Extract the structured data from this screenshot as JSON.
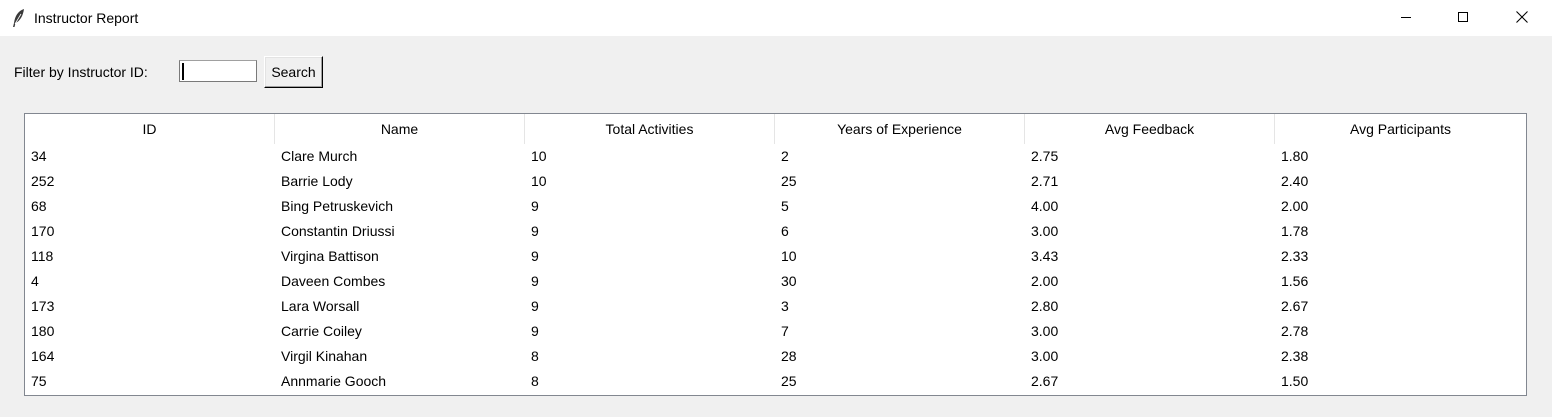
{
  "window": {
    "title": "Instructor Report",
    "icon": "feather-icon",
    "controls": [
      "minimize-icon",
      "maximize-icon",
      "close-icon"
    ]
  },
  "filter": {
    "label": "Filter by Instructor ID:",
    "value": "",
    "button_label": "Search"
  },
  "table": {
    "columns": [
      "ID",
      "Name",
      "Total Activities",
      "Years of Experience",
      "Avg Feedback",
      "Avg Participants"
    ],
    "rows": [
      [
        "34",
        "Clare Murch",
        "10",
        "2",
        "2.75",
        "1.80"
      ],
      [
        "252",
        "Barrie Lody",
        "10",
        "25",
        "2.71",
        "2.40"
      ],
      [
        "68",
        "Bing Petruskevich",
        "9",
        "5",
        "4.00",
        "2.00"
      ],
      [
        "170",
        "Constantin Driussi",
        "9",
        "6",
        "3.00",
        "1.78"
      ],
      [
        "118",
        "Virgina Battison",
        "9",
        "10",
        "3.43",
        "2.33"
      ],
      [
        "4",
        "Daveen Combes",
        "9",
        "30",
        "2.00",
        "1.56"
      ],
      [
        "173",
        "Lara Worsall",
        "9",
        "3",
        "2.80",
        "2.67"
      ],
      [
        "180",
        "Carrie Coiley",
        "9",
        "7",
        "3.00",
        "2.78"
      ],
      [
        "164",
        "Virgil Kinahan",
        "8",
        "28",
        "3.00",
        "2.38"
      ],
      [
        "75",
        "Annmarie Gooch",
        "8",
        "25",
        "2.67",
        "1.50"
      ]
    ]
  }
}
